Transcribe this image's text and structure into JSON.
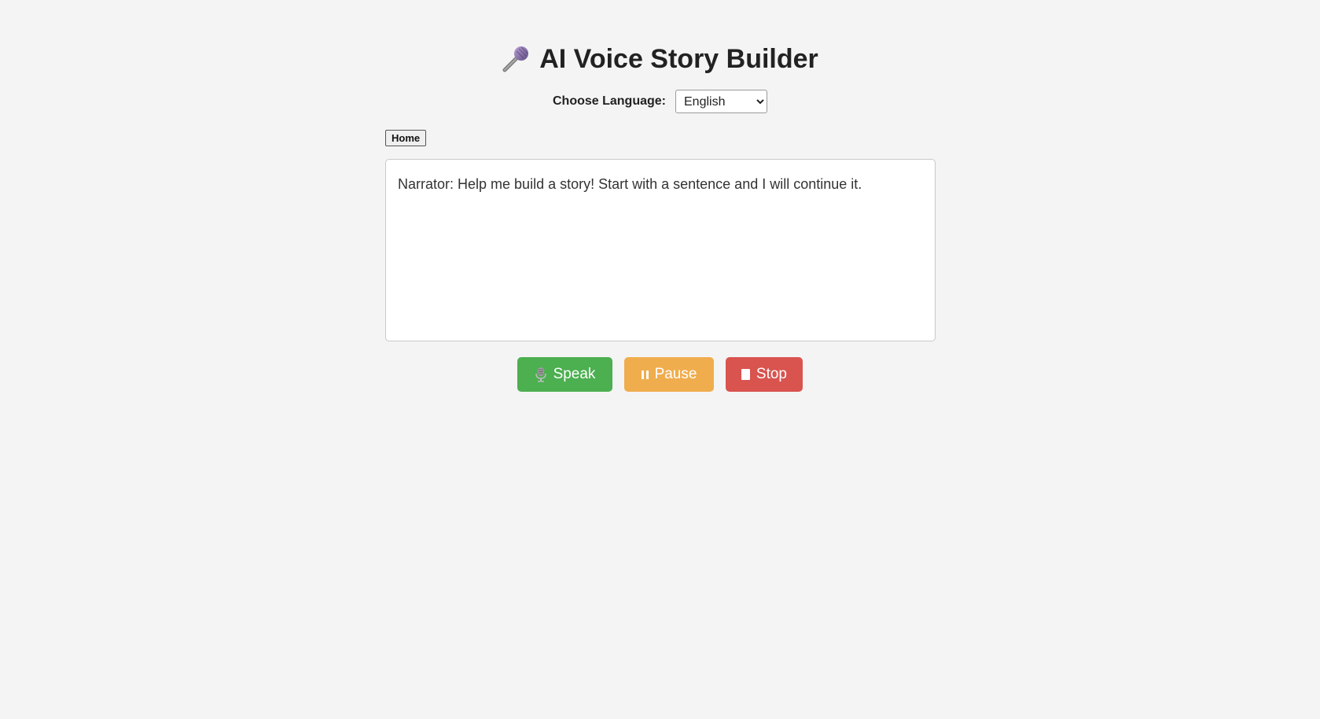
{
  "header": {
    "title": "AI Voice Story Builder",
    "icon": "microphone-icon"
  },
  "language": {
    "label": "Choose Language:",
    "selected": "English"
  },
  "nav": {
    "home_label": "Home"
  },
  "story": {
    "text": "Narrator: Help me build a story! Start with a sentence and I will continue it."
  },
  "controls": {
    "speak_label": "Speak",
    "pause_label": "Pause",
    "stop_label": "Stop"
  },
  "colors": {
    "background": "#f4f4f4",
    "speak": "#4caf50",
    "pause": "#f0ad4e",
    "stop": "#d9534f"
  }
}
